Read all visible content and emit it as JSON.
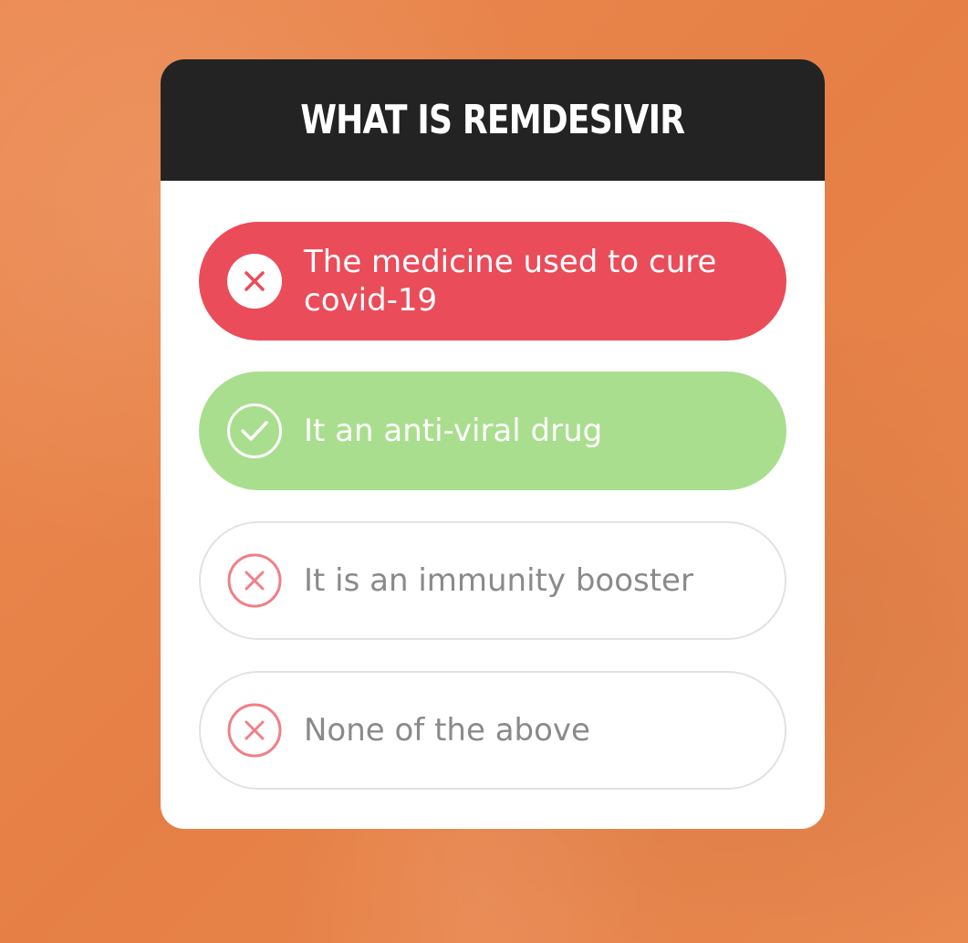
{
  "quiz": {
    "title": "WHAT IS REMDESIVIR",
    "options": [
      {
        "label": "The medicine used to cure covid-19",
        "state": "selected-wrong",
        "icon": "x-circle-icon"
      },
      {
        "label": "It an anti-viral drug",
        "state": "correct",
        "icon": "check-circle-icon"
      },
      {
        "label": "It is an immunity booster",
        "state": "wrong",
        "icon": "x-circle-icon"
      },
      {
        "label": "None of the above",
        "state": "wrong",
        "icon": "x-circle-icon"
      }
    ]
  },
  "colors": {
    "background": "#e9844b",
    "header": "#232323",
    "wrong_selected": "#ea4c5a",
    "correct": "#a9de8e",
    "neutral_border": "#e2e2e2",
    "wrong_icon": "#f07f86"
  }
}
